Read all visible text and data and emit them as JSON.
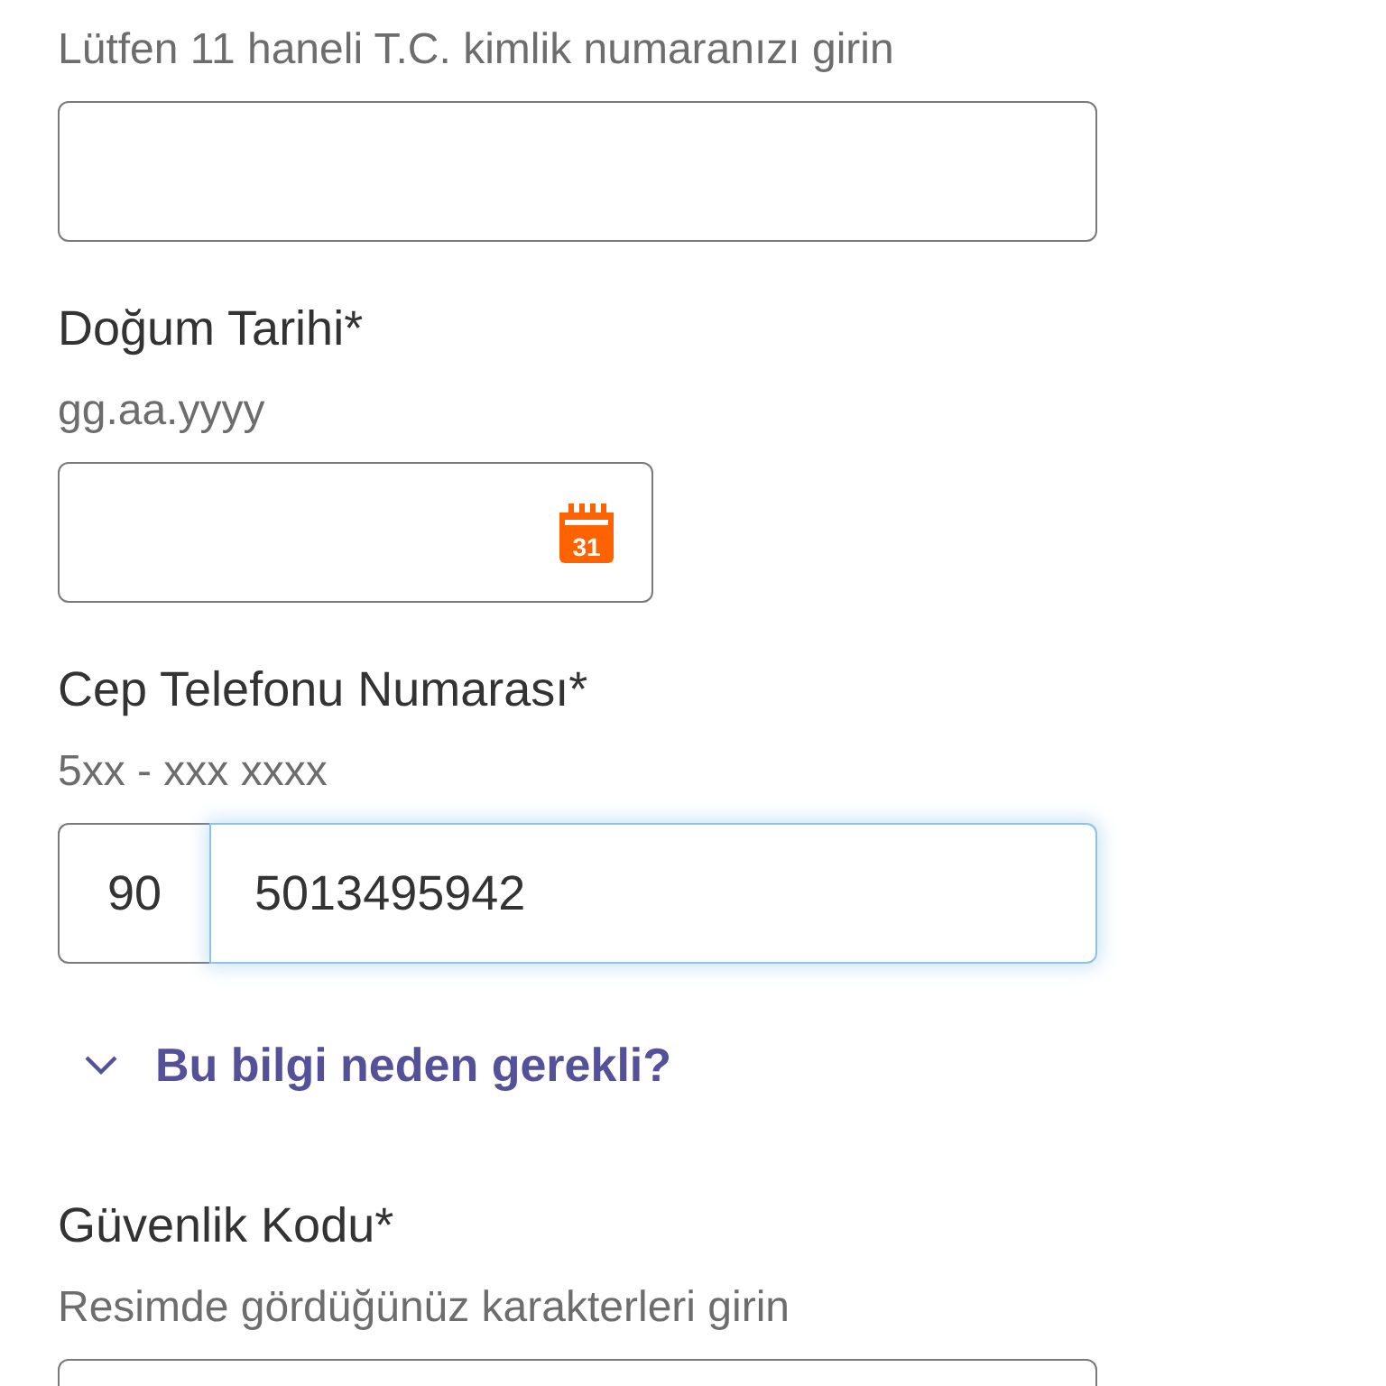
{
  "fields": [
    {
      "kind": "text",
      "hint": "Lütfen 11 haneli T.C. kimlik numaranızı girin"
    },
    {
      "kind": "date",
      "label": "Doğum Tarihi*",
      "hint": "gg.aa.yyyy",
      "calendar_day": "31"
    },
    {
      "kind": "phone",
      "label": "Cep Telefonu Numarası*",
      "hint": "5xx - xxx xxxx",
      "prefix": "90",
      "value": "5013495942",
      "focused": true
    },
    {
      "kind": "link",
      "label": "Bu bilgi neden gerekli?",
      "expanded": false
    },
    {
      "kind": "text",
      "label": "Güvenlik Kodu*",
      "hint": "Resimde gördüğünüz karakterleri girin"
    }
  ]
}
